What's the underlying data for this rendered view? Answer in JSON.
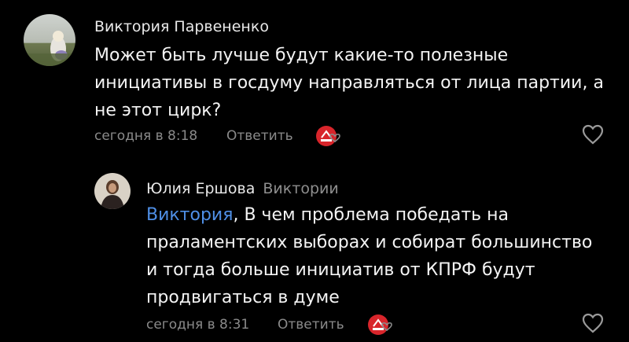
{
  "comments": [
    {
      "author": "Виктория Парвененко",
      "text_lines": [
        "Может быть лучше будут какие-то полезные",
        "инициативы в госдуму направляться от лица партии, а",
        "не этот цирк?"
      ],
      "timestamp": "сегодня в 8:18",
      "reply_label": "Ответить",
      "reaction_icon": "kprf-emblem-reaction",
      "like_icon": "heart-outline-icon"
    },
    {
      "author": "Юлия Ершова",
      "reply_to": "Виктории",
      "mention": "Виктория",
      "first_line_rest": ", В чем проблема победать на",
      "text_lines": [
        "праламентских выборах и собират большинство",
        "и тогда больше инициатив от КПРФ будут",
        "продвигаться в думе"
      ],
      "timestamp": "сегодня в 8:31",
      "reply_label": "Ответить",
      "reaction_icon": "kprf-emblem-reaction",
      "like_icon": "heart-outline-icon"
    }
  ],
  "colors": {
    "background": "#000000",
    "text": "#f4f4f4",
    "muted": "#8a8a8a",
    "mention": "#4f8fe6",
    "reaction_red": "#d8252b"
  }
}
